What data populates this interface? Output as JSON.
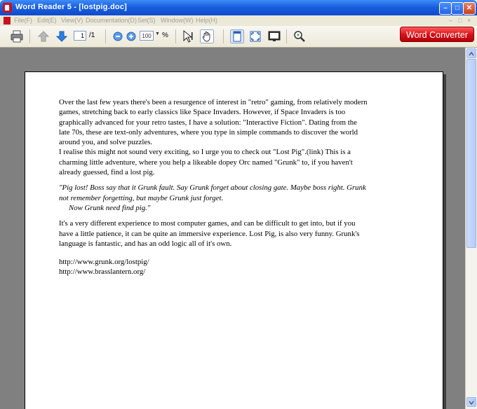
{
  "window": {
    "title": "Word Reader 5 - [lostpig.doc]"
  },
  "menu": {
    "items": [
      "File(F)",
      "Edit(E)",
      "View(V)",
      "Documentation(D)",
      "Set(S)",
      "Window(W)",
      "Help(H)"
    ]
  },
  "toolbar": {
    "page_current": "1",
    "page_total": "/1",
    "zoom_value": "100",
    "zoom_unit": "%",
    "converter_label": "Word Converter"
  },
  "document": {
    "paragraph1": "Over the last few years there's been a resurgence of interest in \"retro\" gaming, from relatively modern games, stretching back to early classics like Space Invaders. However, if Space Invaders is too graphically advanced for your retro tastes, I have a solution: \"Interactive Fiction\". Dating from the late 70s, these are text-only adventures, where you type in simple commands to discover the world around you, and solve puzzles.",
    "paragraph2": "I realise this might not sound very exciting, so I urge you to check out \"Lost Pig\".(link) This is a charming little adventure, where you help a likeable dopey Orc named \"Grunk\" to, if you haven't already guessed, find a lost pig.",
    "quote1": "\"Pig lost! Boss say that it Grunk fault. Say Grunk forget about closing gate. Maybe boss right. Grunk not remember forgetting, but maybe Grunk just forget.",
    "quote2": "Now Grunk need find pig.\"",
    "paragraph3": "It's a very different experience to most computer games, and can be difficult to get into, but if you have a little patience, it can be quite an immersive experience. Lost Pig, is also very funny. Grunk's language is fantastic, and has an odd logic all of it's own.",
    "link1": "http://www.grunk.org/lostpig/",
    "link2": "http://www.brasslantern.org/"
  }
}
